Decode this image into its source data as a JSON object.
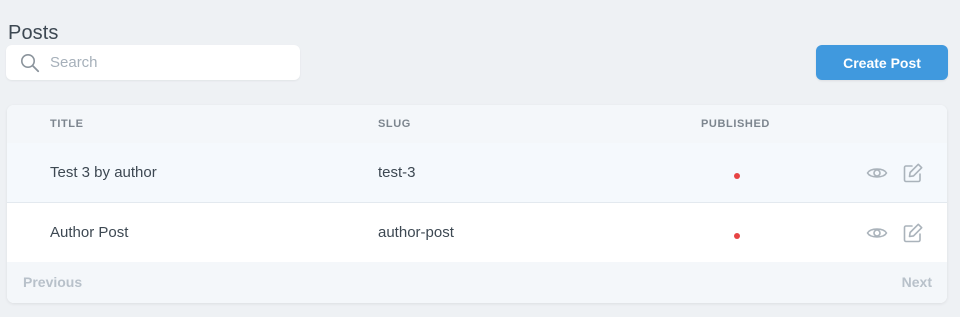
{
  "page": {
    "title": "Posts"
  },
  "search": {
    "placeholder": "Search",
    "value": "",
    "icon": "search-icon"
  },
  "actions": {
    "create_label": "Create Post",
    "create_color": "#4099de"
  },
  "table": {
    "columns": [
      "TITLE",
      "SLUG",
      "PUBLISHED"
    ],
    "rows": [
      {
        "title": "Test 3 by author",
        "slug": "test-3",
        "published": false,
        "published_color": "#e74444",
        "actions": [
          "eye-icon",
          "edit-icon"
        ]
      },
      {
        "title": "Author Post",
        "slug": "author-post",
        "published": false,
        "published_color": "#e74444",
        "actions": [
          "eye-icon",
          "edit-icon"
        ]
      }
    ]
  },
  "pagination": {
    "previous_label": "Previous",
    "next_label": "Next"
  }
}
